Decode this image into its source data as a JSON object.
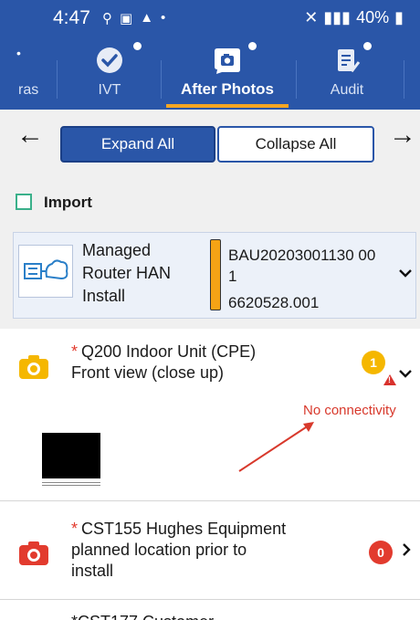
{
  "status_bar": {
    "time": "4:47",
    "battery": "40%",
    "signal": "▮▮▮",
    "icons_left": [
      "location-icon",
      "image-icon",
      "alert-icon",
      "dot"
    ]
  },
  "tabs": [
    {
      "label": "ras",
      "icon": "camera-icon",
      "active": false
    },
    {
      "label": "IVT",
      "icon": "check-circle-icon",
      "active": false
    },
    {
      "label": "After Photos",
      "icon": "camera-icon",
      "active": true
    },
    {
      "label": "Audit",
      "icon": "checklist-icon",
      "active": false
    }
  ],
  "toolbar": {
    "back_arrow": "←",
    "forward_arrow": "→",
    "expand_label": "Expand All",
    "collapse_label": "Collapse All"
  },
  "import": {
    "label": "Import",
    "checked": false
  },
  "order": {
    "title_line1": "Managed",
    "title_line2": "Router HAN",
    "title_line3": "Install",
    "reference": "BAU20203001130 001",
    "number": "6620528.001",
    "chevron": "⌄"
  },
  "items": [
    {
      "star": "*",
      "title_line1": "Q200 Indoor Unit (CPE)",
      "title_line2": "Front view (close up)",
      "count": "1",
      "status": "No connectivity",
      "chevron": "⌄"
    },
    {
      "star": "*",
      "title_line1": "CST155 Hughes Equipment",
      "title_line2": "planned location prior to",
      "title_line3": "install",
      "count": "0",
      "chevron": ">"
    },
    {
      "star": "*",
      "title_line1": "CST177 Customer"
    }
  ],
  "colors": {
    "primary": "#2a56a8",
    "accent": "#f5a623",
    "warning_badge": "#f5b700",
    "error": "#d8392c"
  }
}
